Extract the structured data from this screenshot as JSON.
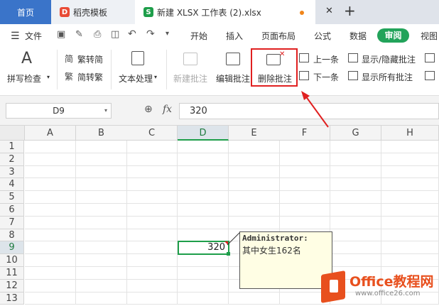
{
  "tabs": {
    "home": "首页",
    "docer": "稻壳模板",
    "file": "新建 XLSX 工作表 (2).xlsx",
    "add": "+",
    "close": "✕"
  },
  "menu": {
    "file": "文件",
    "items": [
      "开始",
      "插入",
      "页面布局",
      "公式",
      "数据",
      "审阅",
      "视图"
    ]
  },
  "ribbon": {
    "spell_check": "拼写检查",
    "to_traditional": "繁转简",
    "to_simplified": "简转繁",
    "text_processing": "文本处理",
    "new_comment": "新建批注",
    "edit_comment": "编辑批注",
    "delete_comment": "删除批注",
    "prev": "上一条",
    "next": "下一条",
    "show_hide": "显示/隐藏批注",
    "show_all": "显示所有批注"
  },
  "formula_bar": {
    "name_box": "D9",
    "fx": "fx",
    "value": "320"
  },
  "grid": {
    "columns": [
      "A",
      "B",
      "C",
      "D",
      "E",
      "F",
      "G",
      "H"
    ],
    "rows": [
      "1",
      "2",
      "3",
      "4",
      "5",
      "6",
      "7",
      "8",
      "9",
      "10",
      "11",
      "12",
      "13"
    ],
    "selected_cell_value": "320"
  },
  "comment": {
    "author": "Administrator:",
    "text": "其中女生162名"
  },
  "watermark": {
    "brand": "Office教程网",
    "url": "www.office26.com"
  },
  "colors": {
    "home_tab": "#3a74c9",
    "review_active": "#22a35a",
    "highlight": "#e02020",
    "selection": "#1e9e4a"
  }
}
